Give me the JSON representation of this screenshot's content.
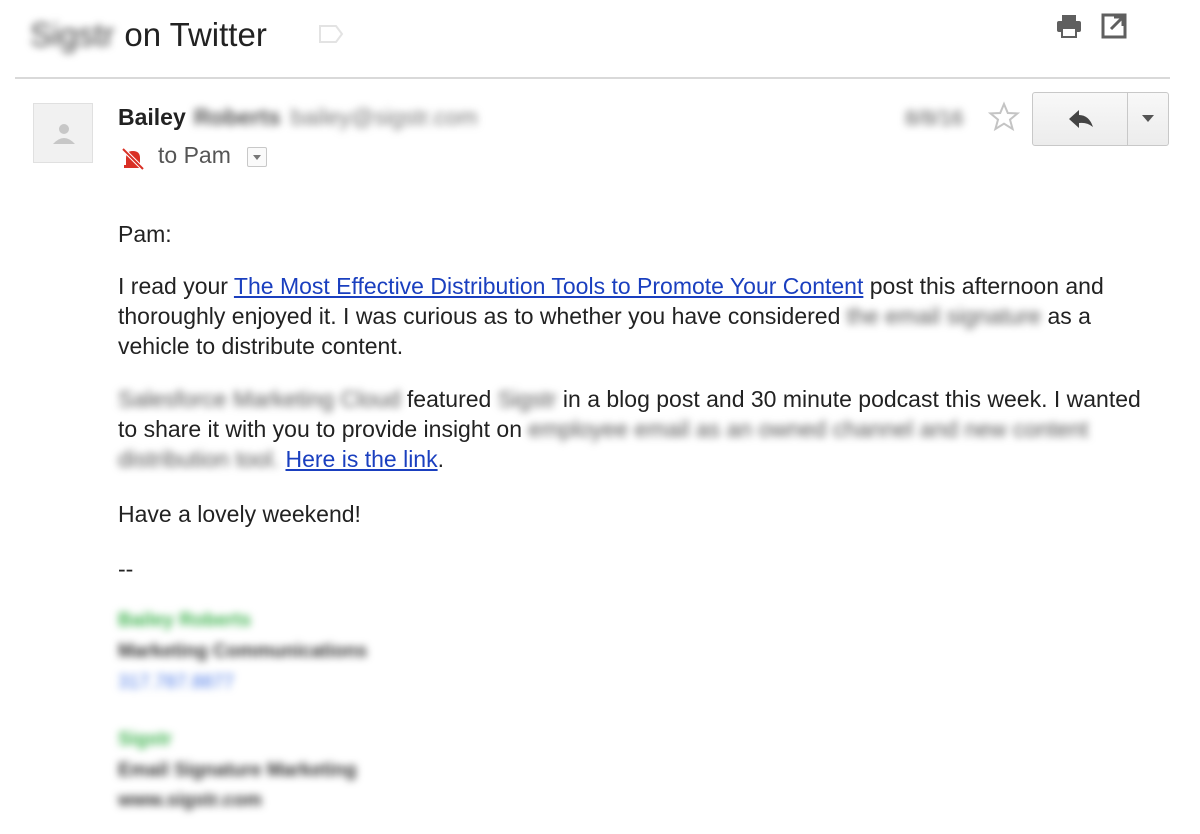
{
  "header": {
    "subject_blurred": "Sigstr",
    "subject_rest": "on Twitter"
  },
  "sender": {
    "first_name": "Bailey",
    "last_name_blurred": "Roberts",
    "email_blurred": "bailey@sigstr.com",
    "to_text": "to Pam",
    "date_blurred": "8/8/16"
  },
  "body": {
    "greeting": "Pam:",
    "p1_before_link": "I read your ",
    "p1_link": "The Most Effective Distribution Tools to Promote Your Content",
    "p1_after_link": " post this afternoon and thoroughly enjoyed it. I was curious as to whether you have considered ",
    "p1_blur": "the email signature",
    "p1_end": " as a vehicle to distribute content.",
    "p2_blur1": "Salesforce Marketing Cloud",
    "p2_featured": " featured ",
    "p2_blur2": "Sigstr",
    "p2_after": " in a blog post and 30 minute podcast this week. I wanted to share it with you to provide insight on ",
    "p2_blur3": "employee email as an owned channel and new content distribution tool.",
    "p2_link": "Here is the link",
    "p2_end": ".",
    "closing": "Have a lovely weekend!",
    "dashes": "--"
  },
  "signature": {
    "name_blurred": "Bailey Roberts",
    "title_blurred": "Marketing Communications",
    "phone_blurred": "317.787.8877",
    "company_blurred": "Sigstr",
    "tagline_blurred": "Email Signature Marketing",
    "web_blurred": "www.sigstr.com"
  },
  "colors": {
    "link": "#1a3fbf",
    "signature_green": "#3fb34f",
    "signature_blue": "#4a78e6",
    "mute_red": "#d93025"
  }
}
